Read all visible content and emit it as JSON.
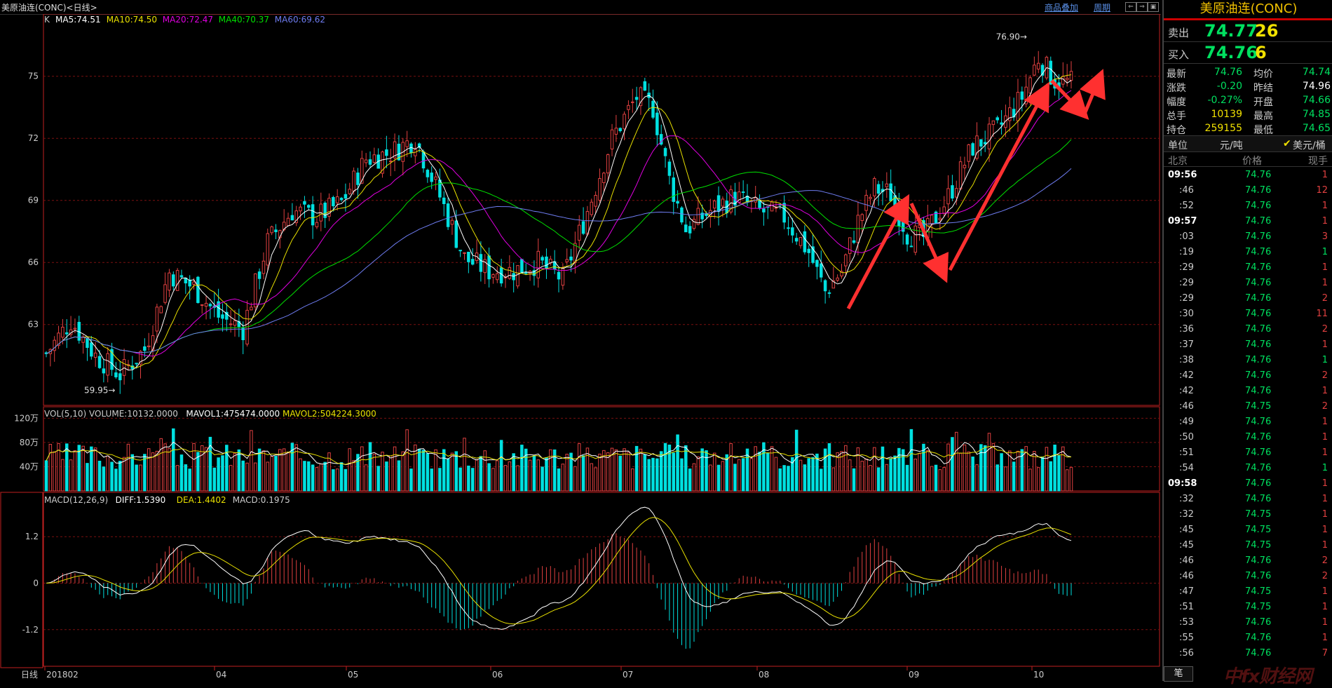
{
  "header": {
    "title": "美原油连(CONC)<日线>",
    "overlay_link": "商品叠加",
    "period_link": "周期",
    "btn_labels": [
      "⇐",
      "⇒",
      "▣"
    ]
  },
  "main_panel": {
    "ma_prefix": "K",
    "ma_labels": [
      {
        "text": "MA5:74.51",
        "color": "#ffffff"
      },
      {
        "text": "MA10:74.50",
        "color": "#e8e000"
      },
      {
        "text": "MA20:72.47",
        "color": "#e000e0"
      },
      {
        "text": "MA40:70.37",
        "color": "#00e000"
      },
      {
        "text": "MA60:69.62",
        "color": "#6e7cf0"
      }
    ],
    "y_ticks": [
      "75",
      "72",
      "69",
      "66",
      "63"
    ],
    "y_values": [
      75,
      72,
      69,
      66,
      63
    ],
    "high_label": "76.90",
    "low_label": "59.95"
  },
  "volume_panel": {
    "labels": [
      {
        "text": "VOL(5,10) VOLUME:10132.0000",
        "color": "#cccccc"
      },
      {
        "text": "MAVOL1:475474.0000",
        "color": "#ffffff"
      },
      {
        "text": "MAVOL2:504224.3000",
        "color": "#e8e000"
      }
    ],
    "y_ticks": [
      "120万",
      "80万",
      "40万"
    ],
    "y_values": [
      120,
      80,
      40
    ]
  },
  "macd_panel": {
    "labels": [
      {
        "text": "MACD(12,26,9)",
        "color": "#cccccc"
      },
      {
        "text": "DIFF:1.5390",
        "color": "#ffffff"
      },
      {
        "text": "DEA:1.4402",
        "color": "#e8e000"
      },
      {
        "text": "MACD:0.1975",
        "color": "#cccccc"
      }
    ],
    "y_ticks": [
      "1.2",
      "0",
      "-1.2"
    ],
    "y_values": [
      1.2,
      0,
      -1.2
    ]
  },
  "x_axis": {
    "period_label": "日线",
    "labels": [
      "201802",
      "04",
      "05",
      "06",
      "07",
      "08",
      "09",
      "10"
    ]
  },
  "sidebar": {
    "title": "美原油连(CONC)",
    "sell": {
      "label": "卖出",
      "price": "74.77",
      "volume": "26"
    },
    "buy": {
      "label": "买入",
      "price": "74.76",
      "volume": "6"
    },
    "stats": [
      {
        "l1": "最新",
        "v1": "74.76",
        "c1": "#00e060",
        "l2": "均价",
        "v2": "74.74",
        "c2": "#00e060"
      },
      {
        "l1": "涨跌",
        "v1": "-0.20",
        "c1": "#00e060",
        "l2": "昨结",
        "v2": "74.96",
        "c2": "#ffffff"
      },
      {
        "l1": "幅度",
        "v1": "-0.27%",
        "c1": "#00e060",
        "l2": "开盘",
        "v2": "74.66",
        "c2": "#00e060"
      },
      {
        "l1": "总手",
        "v1": "10139",
        "c1": "#f0e000",
        "l2": "最高",
        "v2": "74.85",
        "c2": "#00e060"
      },
      {
        "l1": "持仓",
        "v1": "259155",
        "c1": "#f0e000",
        "l2": "最低",
        "v2": "74.65",
        "c2": "#00e060"
      }
    ],
    "unit_label": "单位",
    "unit_value": "元/吨",
    "unit_alt": "美元/桶",
    "tick_headers": {
      "time": "北京",
      "price": "价格",
      "vol": "现手"
    },
    "ticks": [
      {
        "t": "09:56",
        "p": "74.76",
        "v": "1",
        "b": true
      },
      {
        "t": ":46",
        "p": "74.76",
        "v": "12",
        "b": false
      },
      {
        "t": ":52",
        "p": "74.76",
        "v": "1",
        "b": false
      },
      {
        "t": "09:57",
        "p": "74.76",
        "v": "1",
        "b": true
      },
      {
        "t": ":03",
        "p": "74.76",
        "v": "3",
        "b": false
      },
      {
        "t": ":19",
        "p": "74.76",
        "v": "1",
        "b": false
      },
      {
        "t": ":29",
        "p": "74.76",
        "v": "1",
        "b": false
      },
      {
        "t": ":29",
        "p": "74.76",
        "v": "1",
        "b": false
      },
      {
        "t": ":29",
        "p": "74.76",
        "v": "2",
        "b": false
      },
      {
        "t": ":30",
        "p": "74.76",
        "v": "11",
        "b": false
      },
      {
        "t": ":36",
        "p": "74.76",
        "v": "2",
        "b": false
      },
      {
        "t": ":37",
        "p": "74.76",
        "v": "1",
        "b": false
      },
      {
        "t": ":38",
        "p": "74.76",
        "v": "1",
        "b": false
      },
      {
        "t": ":42",
        "p": "74.76",
        "v": "2",
        "b": false
      },
      {
        "t": ":42",
        "p": "74.76",
        "v": "1",
        "b": false
      },
      {
        "t": ":46",
        "p": "74.75",
        "v": "2",
        "b": false
      },
      {
        "t": ":49",
        "p": "74.76",
        "v": "1",
        "b": false
      },
      {
        "t": ":50",
        "p": "74.76",
        "v": "1",
        "b": false
      },
      {
        "t": ":51",
        "p": "74.76",
        "v": "1",
        "b": false
      },
      {
        "t": ":54",
        "p": "74.76",
        "v": "1",
        "b": false
      },
      {
        "t": "09:58",
        "p": "74.76",
        "v": "1",
        "b": true
      },
      {
        "t": ":32",
        "p": "74.76",
        "v": "1",
        "b": false
      },
      {
        "t": ":32",
        "p": "74.75",
        "v": "1",
        "b": false
      },
      {
        "t": ":45",
        "p": "74.75",
        "v": "1",
        "b": false
      },
      {
        "t": ":45",
        "p": "74.75",
        "v": "1",
        "b": false
      },
      {
        "t": ":46",
        "p": "74.76",
        "v": "2",
        "b": false
      },
      {
        "t": ":46",
        "p": "74.76",
        "v": "2",
        "b": false
      },
      {
        "t": ":47",
        "p": "74.75",
        "v": "1",
        "b": false
      },
      {
        "t": ":51",
        "p": "74.75",
        "v": "1",
        "b": false
      },
      {
        "t": ":53",
        "p": "74.76",
        "v": "1",
        "b": false
      },
      {
        "t": ":55",
        "p": "74.76",
        "v": "1",
        "b": false
      },
      {
        "t": ":56",
        "p": "74.76",
        "v": "7",
        "b": false
      }
    ],
    "bottom_tab": "笔",
    "brand_text": "中fx财经网"
  },
  "colors": {
    "up": "#e04040",
    "down": "#00e0e0",
    "grid": "#7a1010",
    "axis": "#c02020",
    "annotation": "#ff3030"
  },
  "chart_data": {
    "type": "candlestick",
    "x_labels": [
      "201802",
      "04",
      "05",
      "06",
      "07",
      "08",
      "09",
      "10"
    ],
    "y_ticks": [
      63,
      66,
      69,
      72,
      75
    ],
    "high": 76.9,
    "low": 59.95,
    "ma_values": {
      "MA5": 74.51,
      "MA10": 74.5,
      "MA20": 72.47,
      "MA40": 70.37,
      "MA60": 69.62
    }
  }
}
